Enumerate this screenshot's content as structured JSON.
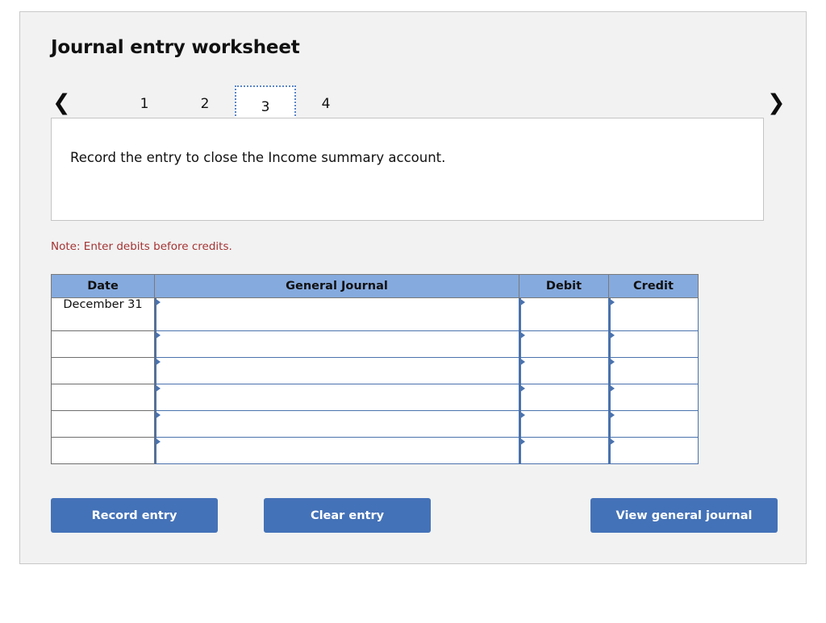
{
  "page": {
    "title": "Journal entry worksheet"
  },
  "tabs": {
    "prev_icon": "chevron-left-icon",
    "next_icon": "chevron-right-icon",
    "items": [
      {
        "label": "1",
        "selected": false
      },
      {
        "label": "2",
        "selected": false
      },
      {
        "label": "3",
        "selected": true
      },
      {
        "label": "4",
        "selected": false
      }
    ]
  },
  "instruction": {
    "text": "Record the entry to close the Income summary account."
  },
  "note": {
    "text": "Note: Enter debits before credits."
  },
  "table": {
    "headers": {
      "date": "Date",
      "general_journal": "General Journal",
      "debit": "Debit",
      "credit": "Credit"
    },
    "rows": [
      {
        "date": "December 31",
        "general_journal": "",
        "debit": "",
        "credit": ""
      },
      {
        "date": "",
        "general_journal": "",
        "debit": "",
        "credit": ""
      },
      {
        "date": "",
        "general_journal": "",
        "debit": "",
        "credit": ""
      },
      {
        "date": "",
        "general_journal": "",
        "debit": "",
        "credit": ""
      },
      {
        "date": "",
        "general_journal": "",
        "debit": "",
        "credit": ""
      },
      {
        "date": "",
        "general_journal": "",
        "debit": "",
        "credit": ""
      }
    ]
  },
  "buttons": {
    "record": "Record entry",
    "clear": "Clear entry",
    "view": "View general journal"
  },
  "colors": {
    "header_blue": "#85aade",
    "button_blue": "#4472b8",
    "cell_border_blue": "#4a72ad",
    "note_red": "#a43333",
    "panel_bg": "#f2f2f2"
  }
}
